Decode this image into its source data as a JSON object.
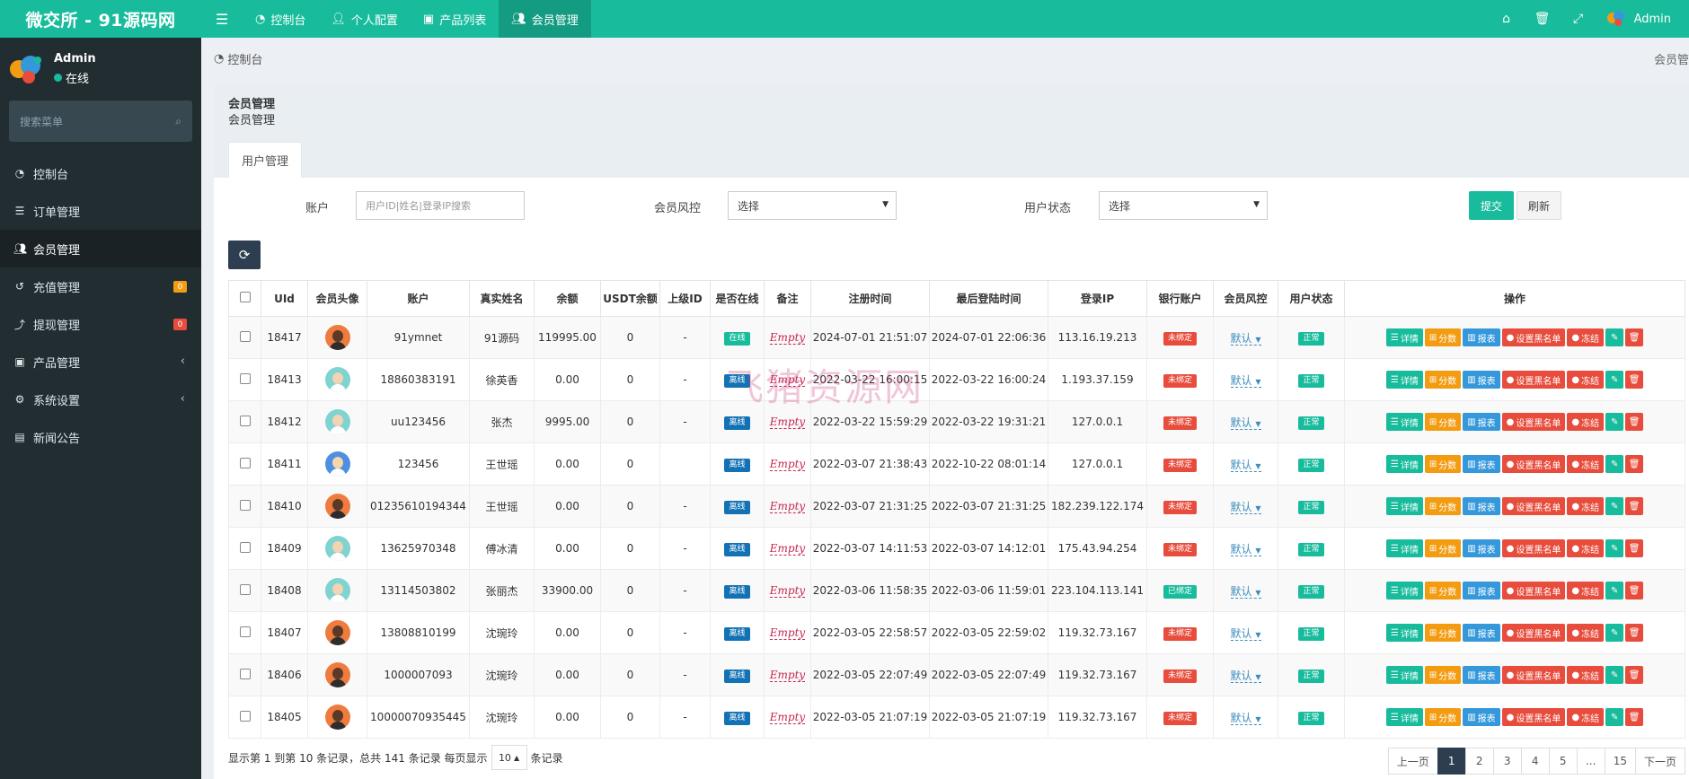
{
  "topbar": {
    "logo": "微交所 - 91源码网",
    "tabs": [
      {
        "label": "控制台",
        "icon": "dashboard-icon"
      },
      {
        "label": "个人配置",
        "icon": "user-icon"
      },
      {
        "label": "产品列表",
        "icon": "briefcase-icon"
      },
      {
        "label": "会员管理",
        "icon": "users-icon"
      }
    ],
    "user": "Admin"
  },
  "sidebar": {
    "username": "Admin",
    "status": "在线",
    "search_placeholder": "搜索菜单",
    "items": [
      {
        "label": "控制台",
        "icon": "dashboard-icon"
      },
      {
        "label": "订单管理",
        "icon": "list-icon"
      },
      {
        "label": "会员管理",
        "icon": "users-icon"
      },
      {
        "label": "充值管理",
        "icon": "recharge-icon",
        "badge": "0"
      },
      {
        "label": "提现管理",
        "icon": "withdraw-icon",
        "badge": "0"
      },
      {
        "label": "产品管理",
        "icon": "briefcase-icon"
      },
      {
        "label": "系统设置",
        "icon": "cogs-icon"
      },
      {
        "label": "新闻公告",
        "icon": "newspaper-icon"
      }
    ]
  },
  "breadcrumb": {
    "home": "控制台",
    "right": "会员管"
  },
  "panel": {
    "title": "会员管理",
    "subtitle": "会员管理",
    "tab": "用户管理"
  },
  "filters": {
    "account_label": "账户",
    "account_placeholder": "用户ID|姓名|登录IP搜索",
    "risk_label": "会员风控",
    "risk_value": "选择",
    "status_label": "用户状态",
    "status_value": "选择",
    "submit": "提交",
    "reset": "刷新"
  },
  "table": {
    "headers": [
      "UId",
      "会员头像",
      "账户",
      "真实姓名",
      "余额",
      "USDT余额",
      "上级ID",
      "是否在线",
      "备注",
      "注册时间",
      "最后登陆时间",
      "登录IP",
      "银行账户",
      "会员风控",
      "用户状态",
      "操作"
    ],
    "ops": {
      "detail": "详情",
      "score": "分数",
      "report": "报表",
      "blacklist": "设置黑名单",
      "freeze": "冻结"
    },
    "rows": [
      {
        "uid": "18417",
        "avatar": "orange",
        "account": "91ymnet",
        "name": "91源码",
        "balance": "119995.00",
        "usdt": "0",
        "parent": "-",
        "online": "在线",
        "note": "Empty",
        "reg": "2024-07-01 21:51:07",
        "last": "2024-07-01 22:06:36",
        "ip": "113.16.19.213",
        "bank": "未绑定",
        "risk": "默认",
        "status": "正常"
      },
      {
        "uid": "18413",
        "avatar": "teal",
        "account": "18860383191",
        "name": "徐英香",
        "balance": "0.00",
        "usdt": "0",
        "parent": "-",
        "online": "离线",
        "note": "Empty",
        "reg": "2022-03-22 16:00:15",
        "last": "2022-03-22 16:00:24",
        "ip": "1.193.37.159",
        "bank": "未绑定",
        "risk": "默认",
        "status": "正常"
      },
      {
        "uid": "18412",
        "avatar": "teal",
        "account": "uu123456",
        "name": "张杰",
        "balance": "9995.00",
        "usdt": "0",
        "parent": "-",
        "online": "离线",
        "note": "Empty",
        "reg": "2022-03-22 15:59:29",
        "last": "2022-03-22 19:31:21",
        "ip": "127.0.0.1",
        "bank": "未绑定",
        "risk": "默认",
        "status": "正常"
      },
      {
        "uid": "18411",
        "avatar": "blue",
        "account": "123456",
        "name": "王世瑶",
        "balance": "0.00",
        "usdt": "0",
        "parent": "",
        "online": "离线",
        "note": "Empty",
        "reg": "2022-03-07 21:38:43",
        "last": "2022-10-22 08:01:14",
        "ip": "127.0.0.1",
        "bank": "未绑定",
        "risk": "默认",
        "status": "正常"
      },
      {
        "uid": "18410",
        "avatar": "orange",
        "account": "01235610194344",
        "name": "王世瑶",
        "balance": "0.00",
        "usdt": "0",
        "parent": "-",
        "online": "离线",
        "note": "Empty",
        "reg": "2022-03-07 21:31:25",
        "last": "2022-03-07 21:31:25",
        "ip": "182.239.122.174",
        "bank": "未绑定",
        "risk": "默认",
        "status": "正常"
      },
      {
        "uid": "18409",
        "avatar": "teal",
        "account": "13625970348",
        "name": "傅冰清",
        "balance": "0.00",
        "usdt": "0",
        "parent": "-",
        "online": "离线",
        "note": "Empty",
        "reg": "2022-03-07 14:11:53",
        "last": "2022-03-07 14:12:01",
        "ip": "175.43.94.254",
        "bank": "未绑定",
        "risk": "默认",
        "status": "正常"
      },
      {
        "uid": "18408",
        "avatar": "teal",
        "account": "13114503802",
        "name": "张丽杰",
        "balance": "33900.00",
        "usdt": "0",
        "parent": "-",
        "online": "离线",
        "note": "Empty",
        "reg": "2022-03-06 11:58:35",
        "last": "2022-03-06 11:59:01",
        "ip": "223.104.113.141",
        "bank": "已绑定",
        "risk": "默认",
        "status": "正常"
      },
      {
        "uid": "18407",
        "avatar": "orange",
        "account": "13808810199",
        "name": "沈琬玲",
        "balance": "0.00",
        "usdt": "0",
        "parent": "-",
        "online": "离线",
        "note": "Empty",
        "reg": "2022-03-05 22:58:57",
        "last": "2022-03-05 22:59:02",
        "ip": "119.32.73.167",
        "bank": "未绑定",
        "risk": "默认",
        "status": "正常"
      },
      {
        "uid": "18406",
        "avatar": "orange",
        "account": "1000007093",
        "name": "沈琬玲",
        "balance": "0.00",
        "usdt": "0",
        "parent": "-",
        "online": "离线",
        "note": "Empty",
        "reg": "2022-03-05 22:07:49",
        "last": "2022-03-05 22:07:49",
        "ip": "119.32.73.167",
        "bank": "未绑定",
        "risk": "默认",
        "status": "正常"
      },
      {
        "uid": "18405",
        "avatar": "orange",
        "account": "10000070935445",
        "name": "沈琬玲",
        "balance": "0.00",
        "usdt": "0",
        "parent": "-",
        "online": "离线",
        "note": "Empty",
        "reg": "2022-03-05 21:07:19",
        "last": "2022-03-05 21:07:19",
        "ip": "119.32.73.167",
        "bank": "未绑定",
        "risk": "默认",
        "status": "正常"
      }
    ]
  },
  "footer": {
    "info_prefix": "显示第 1 到第 10 条记录，总共 141 条记录 每页显示",
    "page_size": "10",
    "info_suffix": "条记录",
    "pager": [
      "上一页",
      "1",
      "2",
      "3",
      "4",
      "5",
      "...",
      "15",
      "下一页"
    ],
    "active_page": "1"
  },
  "watermark": "飞猪资源网",
  "colors": {
    "brand": "#18bc9c",
    "sidebar": "#222d32",
    "danger": "#e74c3c",
    "warning": "#f39c12",
    "info": "#3498db",
    "dark": "#2c3e50"
  }
}
